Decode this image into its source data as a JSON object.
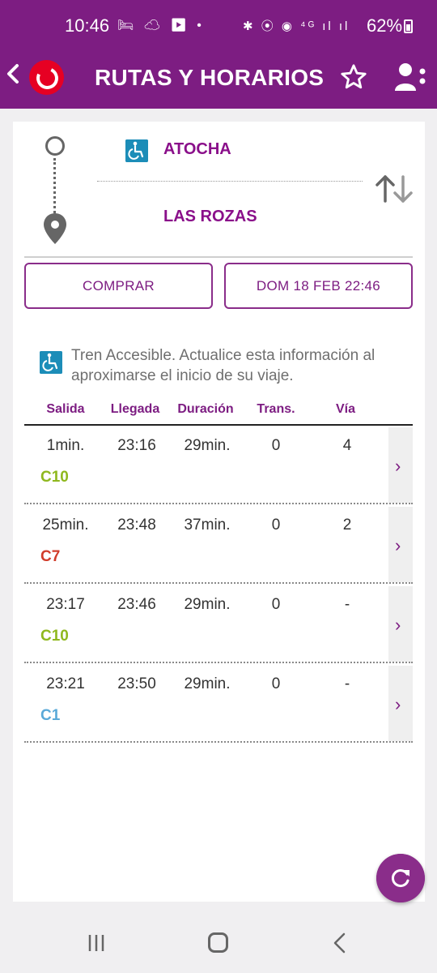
{
  "statusbar": {
    "time": "10:46",
    "left_icons": "🛏 ☁ ▶ •",
    "right_icons": "✱ ⦿ ◉ ⁴ᴳ ıl ıl",
    "battery": "62%"
  },
  "appbar": {
    "title": "RUTAS Y HORARIOS",
    "back_icon": "chevron-left-icon",
    "star_icon": "star-outline-icon",
    "user_icon": "user-settings-icon"
  },
  "route": {
    "origin": "ATOCHA",
    "destination": "LAS ROZAS"
  },
  "buttons": {
    "buy": "COMPRAR",
    "date": "DOM 18 FEB 22:46"
  },
  "accessibility_note": "Tren Accesible. Actualice esta información al aproximarse el inicio de su viaje.",
  "table": {
    "headers": [
      "Salida",
      "Llegada",
      "Duración",
      "Trans.",
      "Vía"
    ],
    "rows": [
      {
        "salida": "1min.",
        "llegada": "23:16",
        "duracion": "29min.",
        "trans": "0",
        "via": "4",
        "linea": "C10",
        "color": "#8fb81e"
      },
      {
        "salida": "25min.",
        "llegada": "23:48",
        "duracion": "37min.",
        "trans": "0",
        "via": "2",
        "linea": "C7",
        "color": "#d13c2b"
      },
      {
        "salida": "23:17",
        "llegada": "23:46",
        "duracion": "29min.",
        "trans": "0",
        "via": "-",
        "linea": "C10",
        "color": "#8fb81e"
      },
      {
        "salida": "23:21",
        "llegada": "23:50",
        "duracion": "29min.",
        "trans": "0",
        "via": "-",
        "linea": "C1",
        "color": "#5aa9d8"
      }
    ]
  },
  "colors": {
    "brand": "#7d1d82",
    "accessible": "#1c8db8"
  }
}
